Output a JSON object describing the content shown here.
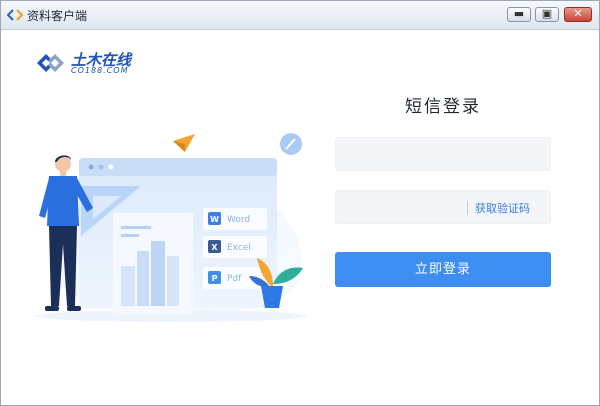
{
  "window": {
    "title": "资料客户端",
    "min_glyph": "▬",
    "max_glyph": "▣",
    "close_glyph": "✕"
  },
  "logo": {
    "name": "土木在线",
    "domain": "CO188.COM"
  },
  "illustration": {
    "files": [
      {
        "badge": "W",
        "label": "Word",
        "color": "#3f7ee8"
      },
      {
        "badge": "X",
        "label": "Excel",
        "color": "#3c5a96"
      },
      {
        "badge": "P",
        "label": "Pdf",
        "color": "#3f8fe8"
      }
    ]
  },
  "login": {
    "title": "短信登录",
    "phone_value": "",
    "phone_placeholder": "",
    "code_value": "",
    "code_placeholder": "",
    "get_code_label": "获取验证码",
    "submit_label": "立即登录"
  },
  "colors": {
    "accent": "#3c8ef0",
    "link": "#3a7de8",
    "logo": "#1f53b4"
  }
}
